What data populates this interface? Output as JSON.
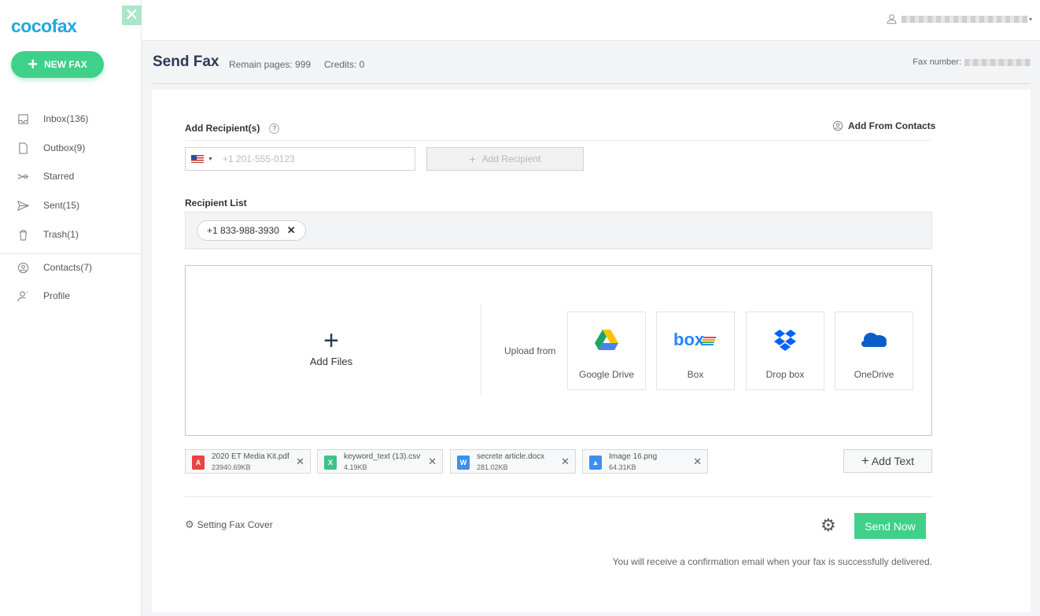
{
  "colors": {
    "brand": "#1ea7e1",
    "accent_green": "#3fd08a",
    "title": "#2b3a55"
  },
  "sidebar": {
    "logo": "cocofax",
    "new_fax_label": "NEW FAX",
    "items": [
      {
        "label": "Inbox(136)",
        "icon": "inbox-icon"
      },
      {
        "label": "Outbox(9)",
        "icon": "document-icon"
      },
      {
        "label": "Starred",
        "icon": "starred-icon"
      },
      {
        "label": "Sent(15)",
        "icon": "send-icon"
      },
      {
        "label": "Trash(1)",
        "icon": "trash-icon"
      },
      {
        "label": "Contacts(7)",
        "icon": "contacts-icon"
      },
      {
        "label": "Profile",
        "icon": "profile-icon"
      }
    ]
  },
  "header": {
    "title": "Send Fax",
    "remain_pages": "Remain pages: 999",
    "credits": "Credits: 0",
    "fax_number_label": "Fax number:"
  },
  "form": {
    "add_recipients_label": "Add Recipient(s)",
    "help_glyph": "?",
    "add_from_contacts": "Add From Contacts",
    "phone_placeholder": "+1 201-555-0123",
    "add_recipient_button": "Add Recipient",
    "recipient_list_label": "Recipient List",
    "recipients": [
      "+1 833-988-3930"
    ]
  },
  "upload": {
    "add_files_label": "Add Files",
    "upload_from_label": "Upload from",
    "sources": [
      "Google Drive",
      "Box",
      "Drop box",
      "OneDrive"
    ]
  },
  "attachments": [
    {
      "name": "2020 ET Media Kit.pdf",
      "size": "23940.69KB",
      "type": "pdf",
      "color": "#e94343"
    },
    {
      "name": "keyword_text (13).csv",
      "size": "4.19KB",
      "type": "csv",
      "color": "#3fc18a"
    },
    {
      "name": "secrete article.docx",
      "size": "281.02KB",
      "type": "docx",
      "color": "#3d8ef0"
    },
    {
      "name": "Image 16.png",
      "size": "64.31KB",
      "type": "png",
      "color": "#3d8ef0"
    }
  ],
  "footer": {
    "add_text_label": "Add Text",
    "fax_cover_label": "Setting Fax Cover",
    "send_label": "Send Now",
    "confirmation": "You will receive a confirmation email when your fax is successfully delivered."
  }
}
